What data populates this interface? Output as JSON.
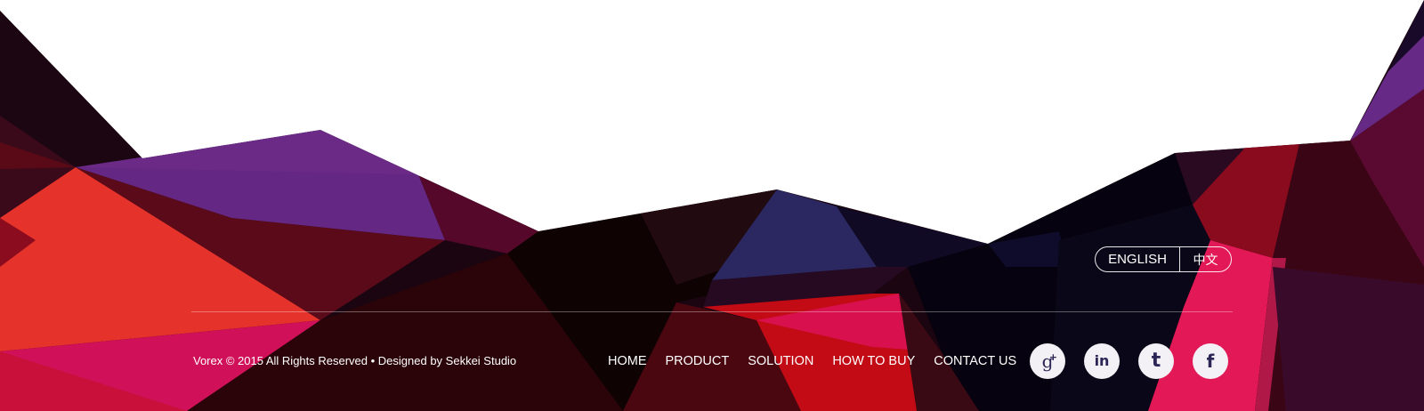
{
  "language_switch": {
    "english_label": "ENGLISH",
    "chinese_label": "中文"
  },
  "footer": {
    "copyright": "Vorex © 2015 All Rights Reserved • Designed by Sekkei Studio"
  },
  "nav": {
    "items": [
      {
        "label": "HOME"
      },
      {
        "label": "PRODUCT"
      },
      {
        "label": "SOLUTION"
      },
      {
        "label": "HOW TO BUY"
      },
      {
        "label": "CONTACT US"
      }
    ]
  },
  "social": [
    {
      "name": "google-plus",
      "icon": "google-plus-icon",
      "glyph": "g"
    },
    {
      "name": "linkedin",
      "icon": "linkedin-icon",
      "glyph": "in"
    },
    {
      "name": "twitter",
      "icon": "twitter-icon",
      "glyph": "t"
    },
    {
      "name": "facebook",
      "icon": "facebook-icon",
      "glyph": "f"
    }
  ],
  "colors": {
    "icon_background": "#f3f1f6",
    "icon_foreground": "#2c2656",
    "text": "#ffffff"
  }
}
